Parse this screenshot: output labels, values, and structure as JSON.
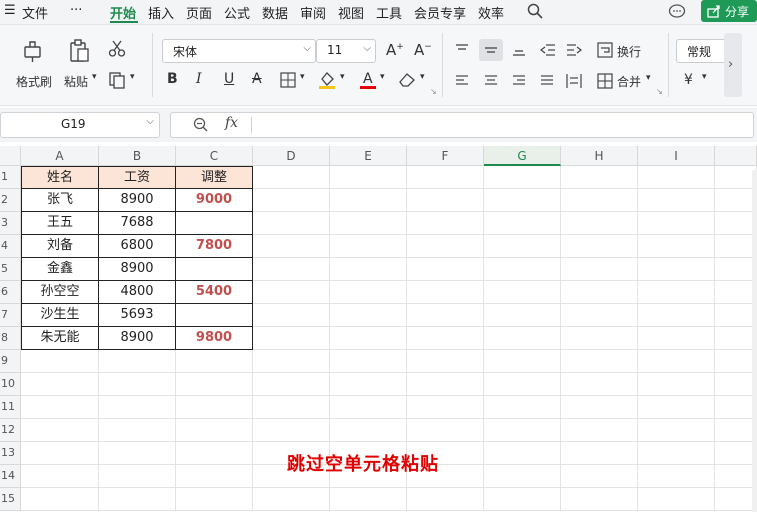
{
  "menu": {
    "hamburger": "☰",
    "file": "文件",
    "more": "···",
    "tabs": [
      "开始",
      "插入",
      "页面",
      "公式",
      "数据",
      "审阅",
      "视图",
      "工具",
      "会员专享",
      "效率"
    ],
    "share": "分享"
  },
  "ribbon": {
    "format_painter": "格式刷",
    "paste": "粘贴",
    "font_name": "宋体",
    "font_size": "11",
    "wrap": "换行",
    "merge": "合并",
    "number_format": "常规",
    "currency_symbol": "¥"
  },
  "formula_bar": {
    "cell_ref": "G19",
    "fx": "fx",
    "value": ""
  },
  "grid": {
    "columns": [
      "A",
      "B",
      "C",
      "D",
      "E",
      "F",
      "G",
      "H",
      "I"
    ],
    "rows": [
      "1",
      "2",
      "3",
      "4",
      "5",
      "6",
      "7",
      "8",
      "9",
      "10",
      "11",
      "12",
      "13",
      "14",
      "15"
    ],
    "header": [
      "姓名",
      "工资",
      "调整"
    ],
    "data": [
      [
        "张飞",
        "8900",
        "9000"
      ],
      [
        "王五",
        "7688",
        ""
      ],
      [
        "刘备",
        "6800",
        "7800"
      ],
      [
        "金鑫",
        "8900",
        ""
      ],
      [
        "孙空空",
        "4800",
        "5400"
      ],
      [
        "沙生生",
        "5693",
        ""
      ],
      [
        "朱无能",
        "8900",
        "9800"
      ]
    ]
  },
  "caption": "跳过空单元格粘贴",
  "colors": {
    "accent": "#1e8b4e",
    "header_fill": "#fce4d6",
    "adjust_text": "#c0504d",
    "caption": "#e00000"
  }
}
